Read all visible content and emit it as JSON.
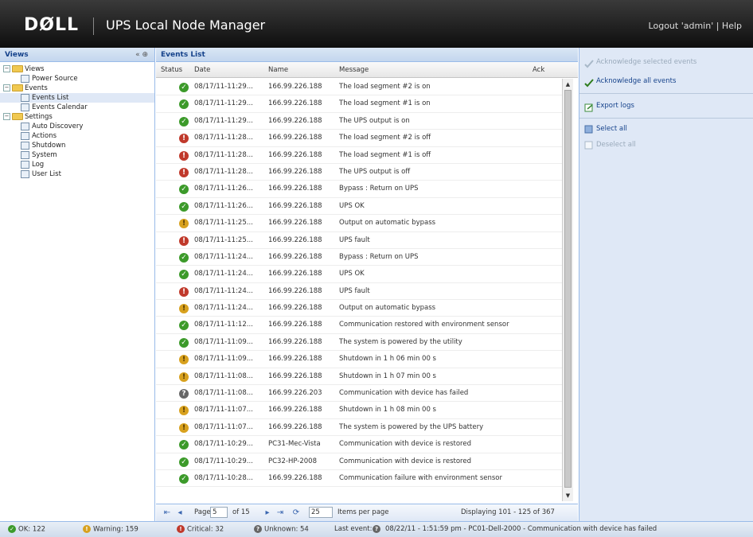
{
  "header": {
    "logo": "DØLL",
    "title": "UPS Local Node Manager",
    "logout": "Logout 'admin' | Help"
  },
  "views_panel": {
    "title": "Views",
    "tools": "« ⊕",
    "tree": [
      {
        "label": "Views",
        "level": 0,
        "type": "folder",
        "toggle": "−"
      },
      {
        "label": "Power Source",
        "level": 1,
        "type": "leaf"
      },
      {
        "label": "Events",
        "level": 0,
        "type": "folder",
        "toggle": "−"
      },
      {
        "label": "Events List",
        "level": 1,
        "type": "leaf",
        "selected": true
      },
      {
        "label": "Events Calendar",
        "level": 1,
        "type": "leaf"
      },
      {
        "label": "Settings",
        "level": 0,
        "type": "folder",
        "toggle": "−"
      },
      {
        "label": "Auto Discovery",
        "level": 1,
        "type": "leaf"
      },
      {
        "label": "Actions",
        "level": 1,
        "type": "leaf"
      },
      {
        "label": "Shutdown",
        "level": 1,
        "type": "leaf"
      },
      {
        "label": "System",
        "level": 1,
        "type": "leaf"
      },
      {
        "label": "Log",
        "level": 1,
        "type": "leaf"
      },
      {
        "label": "User List",
        "level": 1,
        "type": "leaf"
      }
    ]
  },
  "events_panel": {
    "title": "Events List",
    "columns": {
      "status": "Status",
      "date": "Date",
      "name": "Name",
      "message": "Message",
      "ack": "Ack"
    },
    "rows": [
      {
        "status": "ok",
        "date": "08/17/11-11:29...",
        "name": "166.99.226.188",
        "message": "The load segment #2 is on"
      },
      {
        "status": "ok",
        "date": "08/17/11-11:29...",
        "name": "166.99.226.188",
        "message": "The load segment #1 is on"
      },
      {
        "status": "ok",
        "date": "08/17/11-11:29...",
        "name": "166.99.226.188",
        "message": "The UPS output is on"
      },
      {
        "status": "critical",
        "date": "08/17/11-11:28...",
        "name": "166.99.226.188",
        "message": "The load segment #2 is off"
      },
      {
        "status": "critical",
        "date": "08/17/11-11:28...",
        "name": "166.99.226.188",
        "message": "The load segment #1 is off"
      },
      {
        "status": "critical",
        "date": "08/17/11-11:28...",
        "name": "166.99.226.188",
        "message": "The UPS output is off"
      },
      {
        "status": "ok",
        "date": "08/17/11-11:26...",
        "name": "166.99.226.188",
        "message": "Bypass : Return on UPS"
      },
      {
        "status": "ok",
        "date": "08/17/11-11:26...",
        "name": "166.99.226.188",
        "message": "UPS OK"
      },
      {
        "status": "warning",
        "date": "08/17/11-11:25...",
        "name": "166.99.226.188",
        "message": "Output on automatic bypass"
      },
      {
        "status": "critical",
        "date": "08/17/11-11:25...",
        "name": "166.99.226.188",
        "message": "UPS fault"
      },
      {
        "status": "ok",
        "date": "08/17/11-11:24...",
        "name": "166.99.226.188",
        "message": "Bypass : Return on UPS"
      },
      {
        "status": "ok",
        "date": "08/17/11-11:24...",
        "name": "166.99.226.188",
        "message": "UPS OK"
      },
      {
        "status": "critical",
        "date": "08/17/11-11:24...",
        "name": "166.99.226.188",
        "message": "UPS fault"
      },
      {
        "status": "warning",
        "date": "08/17/11-11:24...",
        "name": "166.99.226.188",
        "message": "Output on automatic bypass"
      },
      {
        "status": "ok",
        "date": "08/17/11-11:12...",
        "name": "166.99.226.188",
        "message": "Communication restored with environment sensor"
      },
      {
        "status": "ok",
        "date": "08/17/11-11:09...",
        "name": "166.99.226.188",
        "message": "The system is powered by the utility"
      },
      {
        "status": "warning",
        "date": "08/17/11-11:09...",
        "name": "166.99.226.188",
        "message": "Shutdown in 1 h 06 min 00 s"
      },
      {
        "status": "warning",
        "date": "08/17/11-11:08...",
        "name": "166.99.226.188",
        "message": "Shutdown in 1 h 07 min 00 s"
      },
      {
        "status": "unknown",
        "date": "08/17/11-11:08...",
        "name": "166.99.226.203",
        "message": "Communication with device has failed"
      },
      {
        "status": "warning",
        "date": "08/17/11-11:07...",
        "name": "166.99.226.188",
        "message": "Shutdown in 1 h 08 min 00 s"
      },
      {
        "status": "warning",
        "date": "08/17/11-11:07...",
        "name": "166.99.226.188",
        "message": "The system is powered by the UPS battery"
      },
      {
        "status": "ok",
        "date": "08/17/11-10:29...",
        "name": "PC31-Mec-Vista",
        "message": "Communication with device is restored"
      },
      {
        "status": "ok",
        "date": "08/17/11-10:29...",
        "name": "PC32-HP-2008",
        "message": "Communication with device is restored"
      },
      {
        "status": "ok",
        "date": "08/17/11-10:28...",
        "name": "166.99.226.188",
        "message": "Communication failure with environment sensor"
      }
    ],
    "pager": {
      "page_label": "Page",
      "page_value": "5",
      "of_label": "of 15",
      "per_page_value": "25",
      "per_page_label": "Items per page",
      "displaying": "Displaying 101 - 125 of 367"
    }
  },
  "actions_panel": {
    "items": [
      {
        "label": "Acknowledge selected events",
        "enabled": false,
        "icon": "check-icon"
      },
      {
        "label": "Acknowledge all events",
        "enabled": true,
        "icon": "check-icon"
      },
      {
        "label": "Export logs",
        "enabled": true,
        "icon": "export-icon"
      },
      {
        "label": "Select all",
        "enabled": true,
        "icon": "select-all-icon"
      },
      {
        "label": "Deselect all",
        "enabled": false,
        "icon": "deselect-icon"
      }
    ]
  },
  "statusbar": {
    "ok": "OK: 122",
    "warning": "Warning: 159",
    "critical": "Critical: 32",
    "unknown": "Unknown: 54",
    "last_event_label": "Last event:",
    "last_event": "08/22/11 - 1:51:59 pm - PC01-Dell-2000 - Communication with device has failed"
  },
  "colors": {
    "ok": "#3c9a2a",
    "critical": "#c0392b",
    "warning": "#d8a11e",
    "unknown": "#666666",
    "panel_header": "#15428b"
  }
}
